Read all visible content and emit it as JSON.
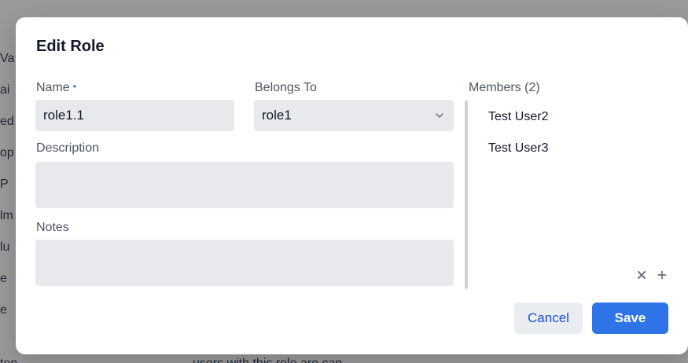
{
  "background": {
    "left_column_snippets": [
      "Va",
      "ai",
      "ed",
      "op",
      "P",
      "lm",
      "lu",
      "e",
      "e"
    ],
    "bottom_left_snippet": "ten",
    "bottom_mid_snippet": "users with this role are can"
  },
  "modal": {
    "title": "Edit Role",
    "fields": {
      "name_label": "Name",
      "name_required_marker": "•",
      "name_value": "role1.1",
      "belongs_to_label": "Belongs To",
      "belongs_to_value": "role1",
      "description_label": "Description",
      "description_value": "",
      "notes_label": "Notes",
      "notes_value": ""
    },
    "members": {
      "header": "Members (2)",
      "items": [
        "Test User2",
        "Test User3"
      ],
      "actions": {
        "remove_icon": "close-icon",
        "add_icon": "plus-icon"
      }
    },
    "buttons": {
      "cancel": "Cancel",
      "save": "Save"
    }
  },
  "colors": {
    "primary": "#2f74e6",
    "cancel_text": "#1d4ed8",
    "input_bg": "#e7e9ec",
    "required_dot": "#2563eb"
  }
}
